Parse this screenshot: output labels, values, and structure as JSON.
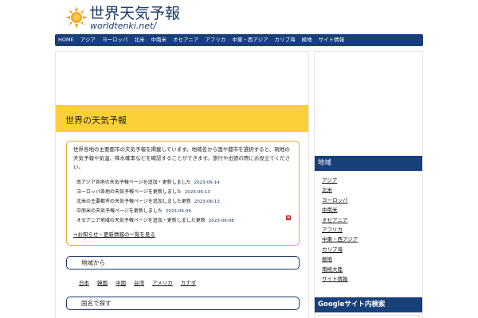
{
  "header": {
    "title": "世界天気予報",
    "url": "worldtenki.net/"
  },
  "colors": {
    "nav_bg": "#173f7a",
    "band_bg": "#fcd03a",
    "notice_border": "#e8a33a",
    "sun": "#f5a623"
  },
  "nav": {
    "items": [
      "HOME",
      "アジア",
      "ヨーロッパ",
      "北米",
      "中南米",
      "オセアニア",
      "アフリカ",
      "中東・西アジア",
      "カリブ海",
      "極地",
      "サイト情報"
    ]
  },
  "main": {
    "page_title": "世界の天気予報",
    "notice": {
      "text": "世界各地の主要都市の天気予報を掲載しています。地域名から国や都市を選択すると、現地の天気予報や気温、降水確率などを確認することができます。旅行や出張の際にお役立てください。",
      "news": [
        {
          "title": "南アジア各地の天気予報ページを追加・更新しました",
          "date": "2023-06-14"
        },
        {
          "title": "ヨーロッパ各地の天気予報ページを更新しました",
          "date": "2023-06-13"
        },
        {
          "title": "北米の主要都市の天気予報ページを追加しました更新",
          "date": "2023-06-13"
        },
        {
          "title": "中南米の天気予報ページを更新しました",
          "date": "2023-06-09"
        },
        {
          "title": "オセアニア地域の天気予報ページを追加・更新しました更新",
          "date": "2023-06-08"
        }
      ],
      "more_link": "⇒お知らせ・更新情報の一覧を見る"
    },
    "sections": {
      "region_label": "地域から",
      "country_label": "国名で探す"
    },
    "region_links": [
      "日本",
      "韓国",
      "中国",
      "台湾",
      "アメリカ",
      "カナダ"
    ]
  },
  "sidebar": {
    "header_1": "地域",
    "links": [
      "アジア",
      "北米",
      "ヨーロッパ",
      "中南米",
      "オセアニア",
      "アフリカ",
      "中東・西アジア",
      "カリブ海",
      "極地",
      "南極大陸",
      "サイト情報"
    ],
    "header_2": "Googleサイト内検索"
  }
}
